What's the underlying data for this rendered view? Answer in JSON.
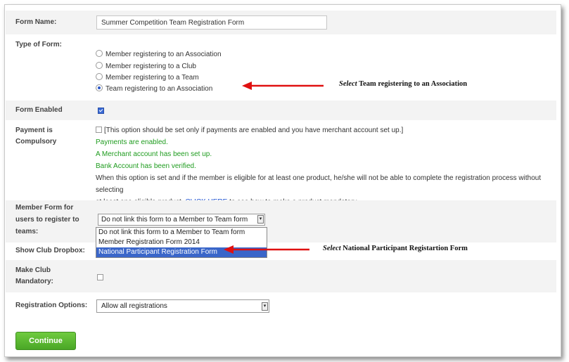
{
  "form_name": {
    "label": "Form Name:",
    "value": "Summer Competition Team Registration Form"
  },
  "type_of_form": {
    "label": "Type of Form:",
    "options": [
      "Member registering to an Association",
      "Member registering to a Club",
      "Member registering to a Team",
      "Team registering to an Association"
    ],
    "selected_index": 3
  },
  "annotation_1": {
    "italic": "Select",
    "text": " Team registering to an Association"
  },
  "form_enabled": {
    "label": "Form Enabled",
    "checked": true
  },
  "payment": {
    "label_line1": "Payment is",
    "label_line2": "Compulsory",
    "checkbox_text": "[This option should be set only if payments are enabled and you have merchant account set up.]",
    "status1": "Payments are enabled.",
    "status2": "A Merchant account has been set up.",
    "status3": "Bank Account has been verified.",
    "note_line1": "When this option is set and if the member is eligible for at least one product, he/she will not be able to complete the registration process without selecting",
    "note_line2_pre": "at least one eligible product. ",
    "note_link": "CLICK HERE",
    "note_line2_post": " to see how to make a product mandatory."
  },
  "member_form": {
    "label_line1": "Member Form for",
    "label_line2": "users to register to",
    "label_line3": "teams:",
    "selected": "Do not link this form to a Member to Team form",
    "options": [
      "Do not link this form to a Member to Team form",
      "Member Registration Form 2014",
      "National Participant Registration Form"
    ],
    "highlighted_index": 2
  },
  "annotation_2": {
    "italic": "Select",
    "text": " National Participant Registartion Form"
  },
  "show_club_dropbox": {
    "label": "Show Club Dropbox:"
  },
  "make_club_mandatory": {
    "label_line1": "Make Club",
    "label_line2": "Mandatory:",
    "checked": false
  },
  "registration_options": {
    "label": "Registration Options:",
    "selected": "Allow all registrations"
  },
  "continue_button": "Continue",
  "colors": {
    "green_text": "#1f9c1f",
    "arrow": "#e01010",
    "button": "#5ab830",
    "highlight": "#3a66c9"
  }
}
